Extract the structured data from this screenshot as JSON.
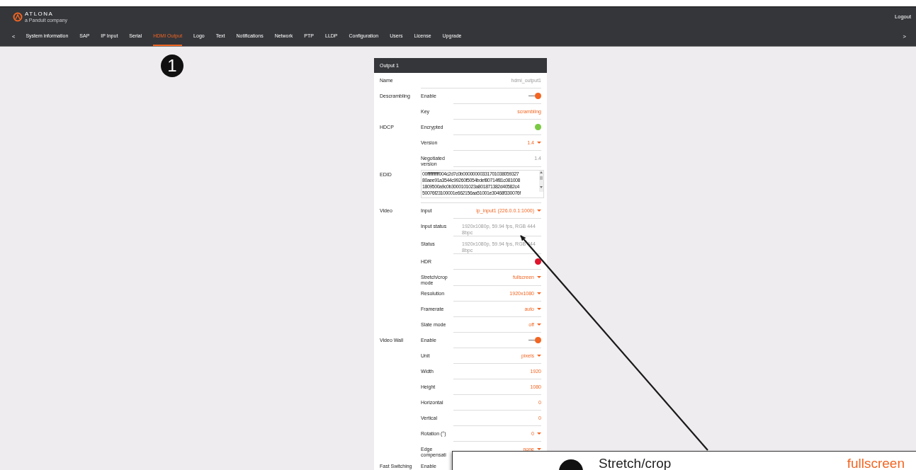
{
  "header": {
    "logo": "ATLONA",
    "logo_tagline": "a Panduit company",
    "logout": "Logout"
  },
  "nav": {
    "prev": "<",
    "next": ">",
    "tabs": [
      {
        "label": "System information",
        "selected": false
      },
      {
        "label": "SAP",
        "selected": false
      },
      {
        "label": "IP Input",
        "selected": false
      },
      {
        "label": "Serial",
        "selected": false
      },
      {
        "label": "HDMI Output",
        "selected": true
      },
      {
        "label": "Logo",
        "selected": false
      },
      {
        "label": "Text",
        "selected": false
      },
      {
        "label": "Notifications",
        "selected": false
      },
      {
        "label": "Network",
        "selected": false
      },
      {
        "label": "PTP",
        "selected": false
      },
      {
        "label": "LLDP",
        "selected": false
      },
      {
        "label": "Configuration",
        "selected": false
      },
      {
        "label": "Users",
        "selected": false
      },
      {
        "label": "License",
        "selected": false
      },
      {
        "label": "Upgrade",
        "selected": false
      }
    ]
  },
  "step_badge": "1",
  "panel": {
    "title": "Output 1",
    "groups": [
      {
        "label": "Name",
        "rows": [
          {
            "kind": "text",
            "value": "hdmi_output1"
          }
        ]
      },
      {
        "label": "Descrambling",
        "rows": [
          {
            "label": "Enable",
            "kind": "toggle",
            "on": true
          },
          {
            "label": "Key",
            "kind": "input",
            "value": "scrambling"
          }
        ]
      },
      {
        "label": "HDCP",
        "rows": [
          {
            "label": "Encrypted",
            "kind": "indicator",
            "color": "#7ac943"
          },
          {
            "label": "Version",
            "kind": "select",
            "value": "1.4"
          },
          {
            "label": "Negotiated version",
            "kind": "text",
            "value": "1.4"
          }
        ]
      },
      {
        "label": "EDID",
        "rows": [
          {
            "kind": "textarea",
            "value": "00ffffffffffff004c2d7c0b00000000331701038059327\n80aee91a3544c99260f5054bdef80714f81c081008\n1809500a9c0b3000101023a801871382d40582c4\n50076f23100001e662156aa51001e30468f330076f"
          }
        ]
      },
      {
        "label": "Video",
        "rows": [
          {
            "label": "Input",
            "kind": "select",
            "value": "ip_input1 (226.0.0.1:1000)"
          },
          {
            "label": "Input status",
            "kind": "text",
            "value": "1920x1080p, 59.94 fps, RGB 444 8bpc"
          },
          {
            "label": "Status",
            "kind": "text",
            "value": "1920x1080p, 59.94 fps, RGB 444 8bpc"
          },
          {
            "label": "HDR",
            "kind": "indicator",
            "color": "#e0142c"
          },
          {
            "label": "Stretch/crop mode",
            "kind": "select",
            "value": "fullscreen"
          },
          {
            "label": "Resolution",
            "kind": "select",
            "value": "1920x1080"
          },
          {
            "label": "Framerate",
            "kind": "select",
            "value": "auto"
          },
          {
            "label": "Slate mode",
            "kind": "select",
            "value": "off"
          }
        ]
      },
      {
        "label": "Video Wall",
        "rows": [
          {
            "label": "Enable",
            "kind": "toggle",
            "on": true
          },
          {
            "label": "Unit",
            "kind": "select",
            "value": "pixels"
          },
          {
            "label": "Width",
            "kind": "input",
            "value": "1920"
          },
          {
            "label": "Height",
            "kind": "input",
            "value": "1080"
          },
          {
            "label": "Horizontal",
            "kind": "input",
            "value": "0"
          },
          {
            "label": "Vertical",
            "kind": "input",
            "value": "0"
          },
          {
            "label": "Rotation (°)",
            "kind": "select",
            "value": "0"
          },
          {
            "label": "Edge compensati",
            "kind": "select",
            "value": "none"
          }
        ]
      },
      {
        "label": "Fast Switching",
        "rows": [
          {
            "label": "Enable",
            "kind": "text"
          }
        ]
      }
    ]
  },
  "callout": {
    "label": "Stretch/crop",
    "value": "fullscreen"
  }
}
